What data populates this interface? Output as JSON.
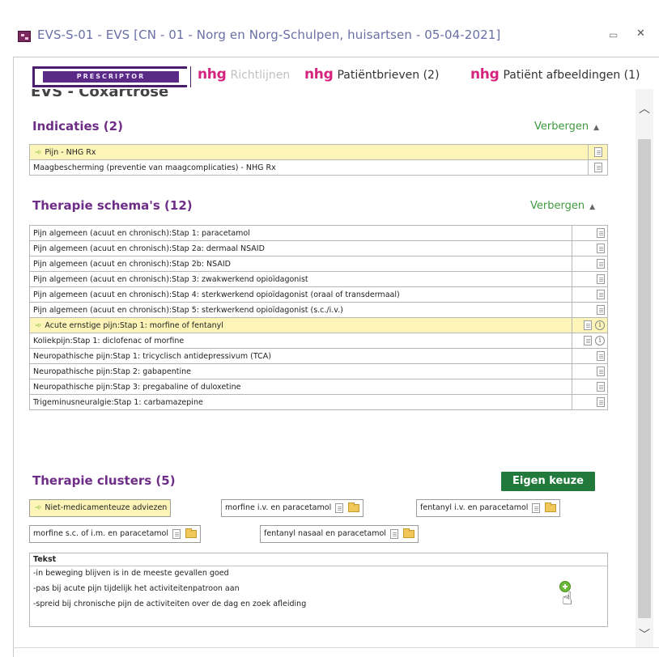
{
  "window": {
    "title": "EVS-S-01 - EVS   [CN - 01 - Norg en Norg-Schulpen, huisartsen - 05-04-2021]",
    "min_icon": "minimize-icon",
    "close_icon": "close-icon"
  },
  "tabs": {
    "prescriptor": "PRESCRIPTOR",
    "items": [
      {
        "brand": "nhg",
        "label": "Richtlijnen",
        "dimmed": true
      },
      {
        "brand": "nhg",
        "label": "Patiëntbrieven (2)",
        "dimmed": false
      },
      {
        "brand": "nhg",
        "label": "Patiënt afbeeldingen (1)",
        "dimmed": false
      }
    ]
  },
  "peek_heading": "EVS - Coxartrose",
  "indicaties": {
    "title": "Indicaties (2)",
    "toggle": "Verbergen",
    "rows": [
      {
        "label": "Pijn - NHG Rx",
        "highlighted": true
      },
      {
        "label": "Maagbescherming (preventie van maagcomplicaties) - NHG Rx",
        "highlighted": false
      }
    ]
  },
  "schemas": {
    "title": "Therapie schema's (12)",
    "toggle": "Verbergen",
    "rows": [
      {
        "label": "Pijn algemeen (acuut en chronisch):Stap 1: paracetamol",
        "highlighted": false,
        "info": false
      },
      {
        "label": "Pijn algemeen (acuut en chronisch):Stap 2a: dermaal NSAID",
        "highlighted": false,
        "info": false
      },
      {
        "label": "Pijn algemeen (acuut en chronisch):Stap 2b: NSAID",
        "highlighted": false,
        "info": false
      },
      {
        "label": "Pijn algemeen (acuut en chronisch):Stap 3: zwakwerkend opioïdagonist",
        "highlighted": false,
        "info": false
      },
      {
        "label": "Pijn algemeen (acuut en chronisch):Stap 4: sterkwerkend opioïdagonist (oraal of transdermaal)",
        "highlighted": false,
        "info": false
      },
      {
        "label": "Pijn algemeen (acuut en chronisch):Stap 5: sterkwerkend opioïdagonist (s.c./i.v.)",
        "highlighted": false,
        "info": false
      },
      {
        "label": "Acute ernstige pijn:Stap 1: morfine of fentanyl",
        "highlighted": true,
        "info": true
      },
      {
        "label": "Koliekpijn:Stap 1: diclofenac of morfine",
        "highlighted": false,
        "info": true
      },
      {
        "label": "Neuropathische pijn:Stap 1: tricyclisch antidepressivum (TCA)",
        "highlighted": false,
        "info": false
      },
      {
        "label": "Neuropathische pijn:Stap 2: gabapentine",
        "highlighted": false,
        "info": false
      },
      {
        "label": "Neuropathische pijn:Stap 3: pregabaline of duloxetine",
        "highlighted": false,
        "info": false
      },
      {
        "label": "Trigeminusneuralgie:Stap 1: carbamazepine",
        "highlighted": false,
        "info": false
      }
    ]
  },
  "clusters": {
    "title": "Therapie clusters (5)",
    "own_choice": "Eigen keuze",
    "chips": [
      {
        "label": "Niet-medicamenteuze adviezen",
        "highlighted": true
      },
      {
        "label": "morfine i.v. en paracetamol",
        "highlighted": false
      },
      {
        "label": "fentanyl i.v. en paracetamol",
        "highlighted": false
      },
      {
        "label": "morfine s.c. of i.m. en paracetamol",
        "highlighted": false
      },
      {
        "label": "fentanyl nasaal en paracetamol",
        "highlighted": false
      }
    ]
  },
  "tekst": {
    "header": "Tekst",
    "lines": [
      "-in beweging blijven is in de meeste gevallen goed",
      "-pas bij acute pijn tijdelijk het activiteitenpatroon aan",
      "-spreid bij chronische pijn de activiteiten over de dag en zoek afleiding"
    ]
  },
  "colors": {
    "section_title": "#6e2d86",
    "toggle_link": "#3f9a3f",
    "highlight_row": "#fdf5b8",
    "nhg_brand": "#d6247e",
    "eigen_keuze_bg": "#217a3c"
  }
}
